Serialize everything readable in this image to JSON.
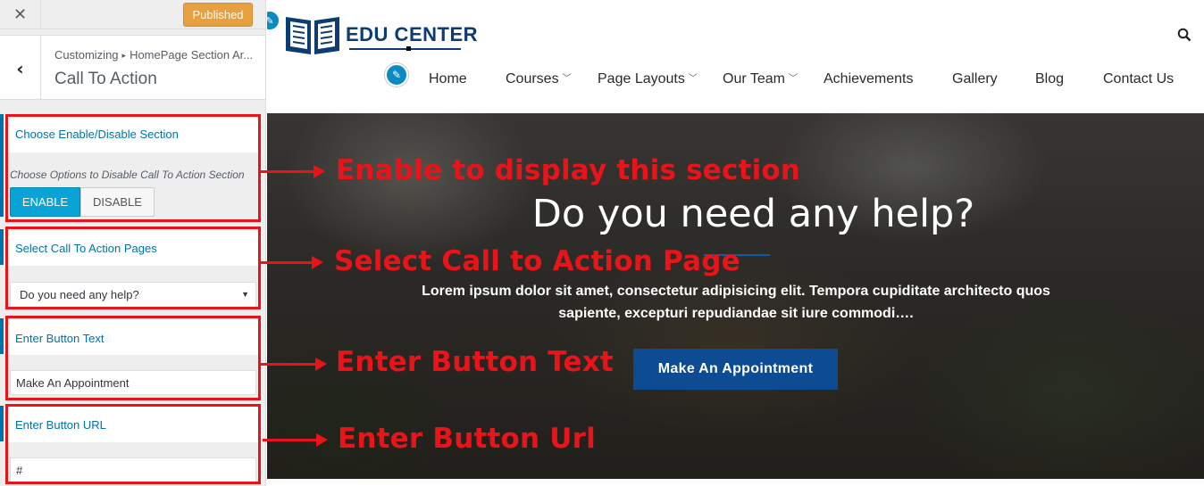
{
  "panel": {
    "close_label": "✕",
    "publish_label": "Published",
    "back_label": "‹",
    "breadcrumb": {
      "root": "Customizing",
      "separator": "▸",
      "parent": "HomePage Section Ar..."
    },
    "section_title": "Call To Action",
    "controls": {
      "enable_section": {
        "title": "Choose Enable/Disable Section",
        "description": "Choose Options to Disable Call To Action Section",
        "enable_label": "ENABLE",
        "disable_label": "DISABLE",
        "selected": "ENABLE"
      },
      "pages": {
        "title": "Select Call To Action Pages",
        "selected_value": "Do you need any help?"
      },
      "button_text": {
        "title": "Enter Button Text",
        "value": "Make An Appointment"
      },
      "button_url": {
        "title": "Enter Button URL",
        "value": "#"
      }
    },
    "accent_color": "#0073aa",
    "publish_color": "#e6a03f"
  },
  "site": {
    "logo_text": "EDU CENTER",
    "nav": [
      {
        "label": "Home",
        "dropdown": false
      },
      {
        "label": "Courses",
        "dropdown": true
      },
      {
        "label": "Page Layouts",
        "dropdown": true
      },
      {
        "label": "Our Team",
        "dropdown": true
      },
      {
        "label": "Achievements",
        "dropdown": false
      },
      {
        "label": "Gallery",
        "dropdown": false
      },
      {
        "label": "Blog",
        "dropdown": false
      },
      {
        "label": "Contact Us",
        "dropdown": false
      }
    ],
    "icons": [
      "search-icon",
      "pencil-edit-icon",
      "book-logo-icon"
    ],
    "hero": {
      "title": "Do you need any help?",
      "text": "Lorem ipsum dolor sit amet, consectetur adipisicing elit. Tempora cupiditate architecto quos sapiente, excepturi repudiandae sit iure commodi….",
      "button_label": "Make An Appointment"
    },
    "brand_color": "#0d3c72"
  },
  "annotations": {
    "enable": "Enable to display this section",
    "select_page": "Select Call to Action Page",
    "button_text": "Enter Button Text",
    "button_url": "Enter Button Url",
    "color": "#e8141a"
  }
}
